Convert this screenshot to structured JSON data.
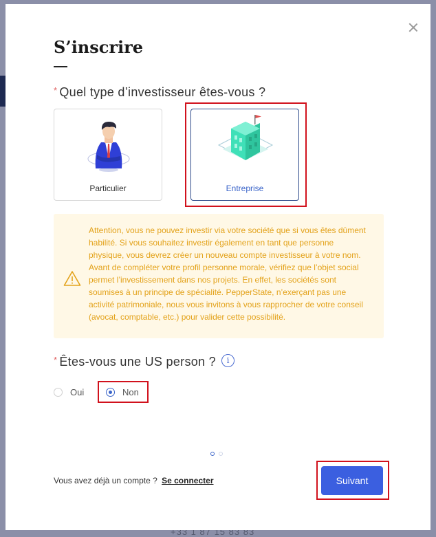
{
  "background": {
    "phone": "+33 1 87 15 83 83"
  },
  "modal": {
    "title": "S’inscrire",
    "close_icon": "close-icon",
    "investor_type": {
      "question": "Quel type d’investisseur êtes-vous ?",
      "required_mark": "*",
      "options": [
        {
          "label": "Particulier",
          "icon": "person-illustration",
          "selected": false
        },
        {
          "label": "Entreprise",
          "icon": "building-illustration",
          "selected": true
        }
      ]
    },
    "warning": {
      "icon": "warning-triangle-icon",
      "text": "Attention, vous ne pouvez investir via votre société que si vous êtes dûment habilité. Si vous souhaitez investir également en tant que personne physique, vous devrez créer un nouveau compte investisseur à votre nom. Avant de compléter votre profil personne morale, vérifiez que l’objet social permet l’investissement dans nos projets. En effet, les sociétés sont soumises à un principe de spécialité. PepperState, n’exerçant pas une activité patrimoniale, nous vous invitons à vous rapprocher de votre conseil (avocat, comptable, etc.) pour valider cette possibilité."
    },
    "us_person": {
      "question": "Êtes-vous une US person ?",
      "required_mark": "*",
      "info_icon": "i",
      "options": [
        {
          "label": "Oui",
          "checked": false
        },
        {
          "label": "Non",
          "checked": true
        }
      ]
    },
    "pagination": {
      "current": 1,
      "total": 2
    },
    "footer": {
      "login_prompt": "Vous avez déjà un compte ?",
      "login_link": "Se connecter",
      "next_button": "Suivant"
    },
    "colors": {
      "primary": "#3b5fe0",
      "highlight": "#d1111c",
      "warning_bg": "#fff8e6",
      "warning_text": "#e3a21a"
    }
  }
}
